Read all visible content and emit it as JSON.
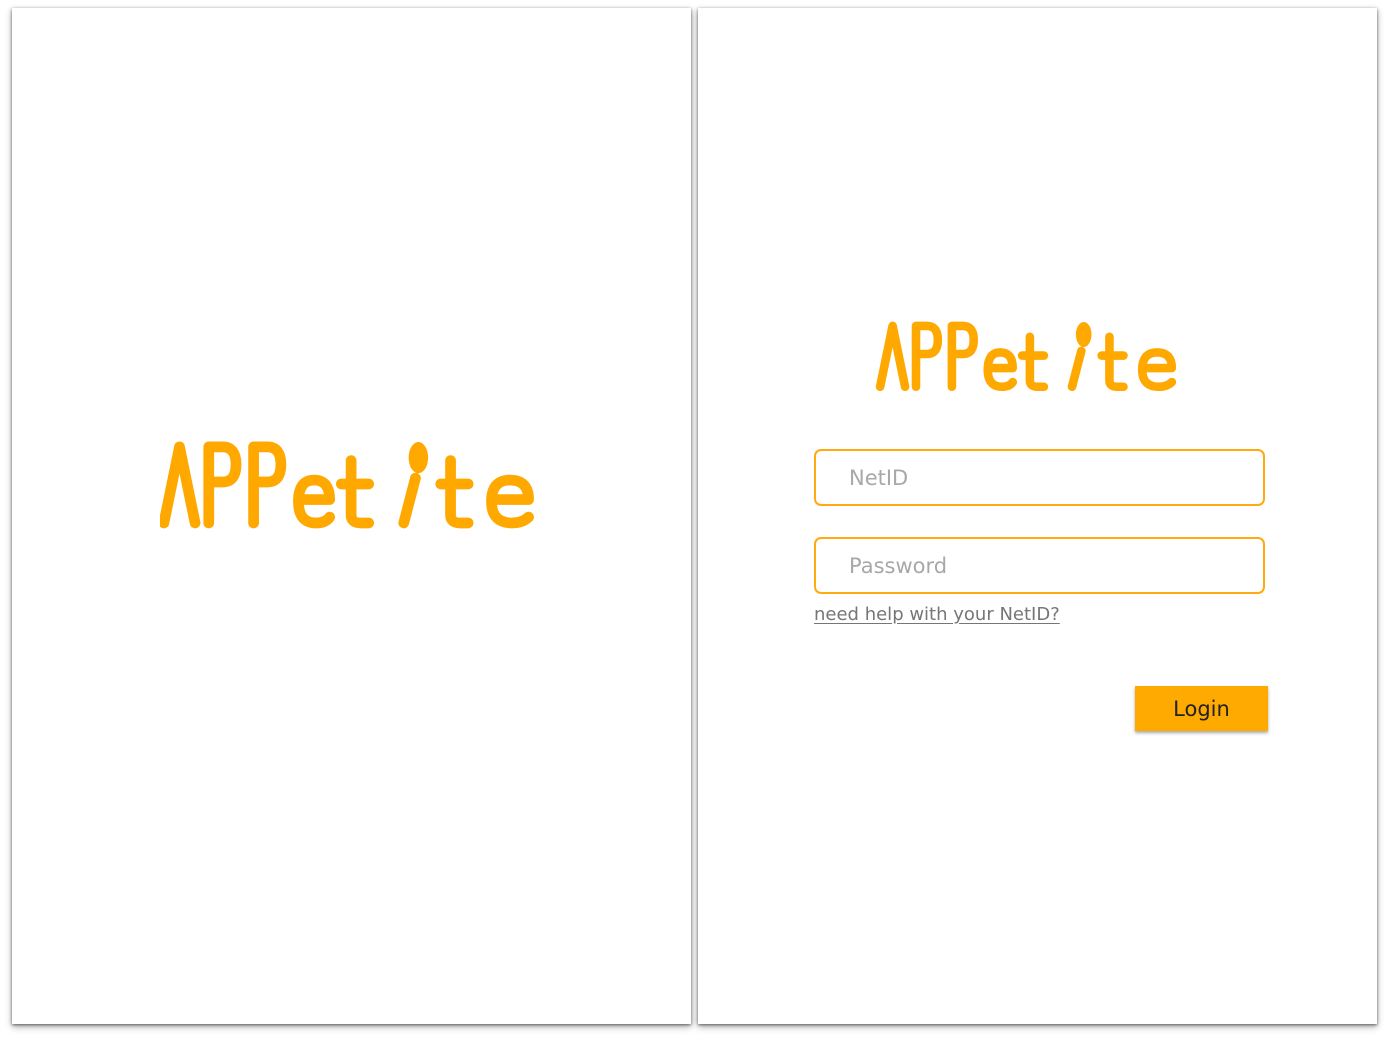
{
  "brand": {
    "name": "APPetite",
    "color": "#FFA800"
  },
  "login": {
    "netid_placeholder": "NetID",
    "password_placeholder": "Password",
    "help_link": "need help with your NetID?",
    "button_label": "Login",
    "field_border_color": "#FFAA10",
    "button_color": "#FFAA00"
  }
}
